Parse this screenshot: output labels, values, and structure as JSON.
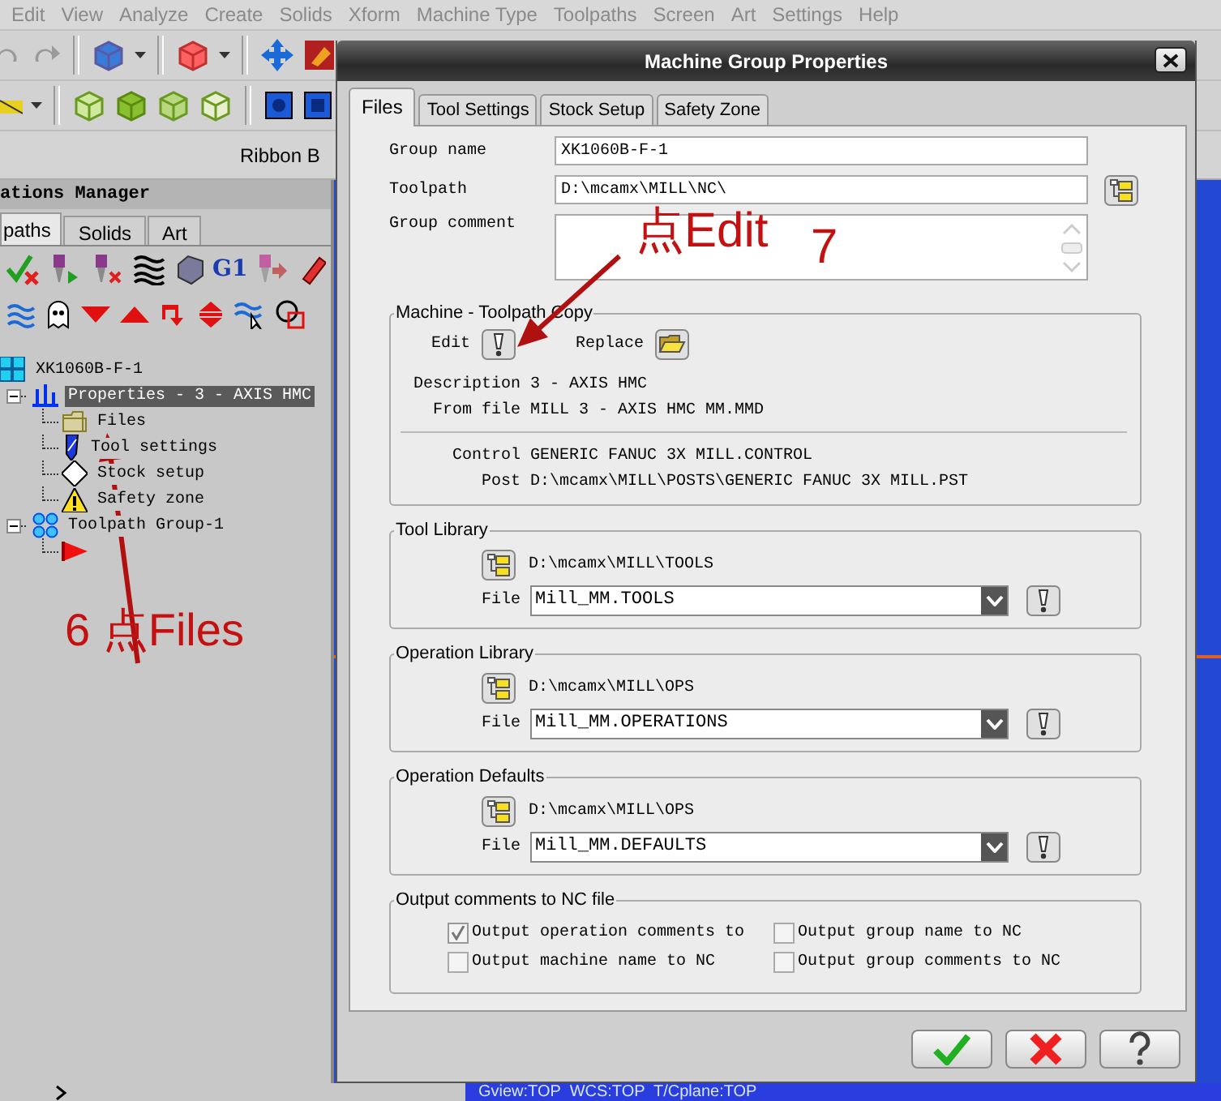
{
  "menu_bar": {
    "items": [
      "Edit",
      "View",
      "Analyze",
      "Create",
      "Solids",
      "Xform",
      "Machine Type",
      "Toolpaths",
      "Screen",
      "Art",
      "Settings",
      "Help"
    ]
  },
  "ribbon_bar": {
    "label": "Ribbon B"
  },
  "manager": {
    "title": "ations Manager",
    "tabs": [
      {
        "label": "paths",
        "selected": true
      },
      {
        "label": "Solids",
        "selected": false
      },
      {
        "label": "Art",
        "selected": false
      }
    ],
    "toolbar_label": "G1",
    "tree": [
      {
        "kind": "group",
        "label": "XK1060B-F-1",
        "selected": false,
        "children": [
          {
            "kind": "properties",
            "label": "Properties - 3 - AXIS HMC",
            "selected": true,
            "expanded": true,
            "children": [
              {
                "kind": "files",
                "label": "Files",
                "selected": false
              },
              {
                "kind": "tool",
                "label": "Tool settings",
                "selected": false
              },
              {
                "kind": "stock",
                "label": "Stock setup",
                "selected": false
              },
              {
                "kind": "safety",
                "label": "Safety zone",
                "selected": false
              }
            ]
          },
          {
            "kind": "toolpath_group",
            "label": "Toolpath Group-1",
            "selected": false,
            "expanded": true,
            "children": [
              {
                "kind": "insert_marker",
                "selected": false
              }
            ]
          }
        ]
      }
    ]
  },
  "status_bar": {
    "text": "Gview:TOP  WCS:TOP  T/Cplane:TOP"
  },
  "dialog": {
    "title": "Machine Group Properties",
    "tabs": [
      {
        "label": "Files",
        "selected": true
      },
      {
        "label": "Tool Settings",
        "selected": false
      },
      {
        "label": "Stock Setup",
        "selected": false
      },
      {
        "label": "Safety Zone",
        "selected": false
      }
    ],
    "group_name": {
      "label": "Group name",
      "value": "XK1060B-F-1"
    },
    "toolpath": {
      "label": "Toolpath",
      "value": "D:\\mcamx\\MILL\\NC\\"
    },
    "group_comment": {
      "label": "Group comment"
    },
    "machine_copy": {
      "title": "Machine - Toolpath Copy",
      "edit_label": "Edit",
      "replace_label": "Replace",
      "info": [
        {
          "label": "Description",
          "value": "3 - AXIS HMC"
        },
        {
          "label": "From file",
          "value": "MILL 3 - AXIS HMC MM.MMD"
        }
      ],
      "control": [
        {
          "label": "Control",
          "value": "GENERIC FANUC 3X MILL.CONTROL"
        },
        {
          "label": "Post",
          "value": "D:\\mcamx\\MILL\\POSTS\\GENERIC FANUC 3X MILL.PST"
        }
      ]
    },
    "libraries": [
      {
        "title": "Tool Library",
        "path": "D:\\mcamx\\MILL\\TOOLS",
        "file_label": "File",
        "file": "Mill_MM.TOOLS"
      },
      {
        "title": "Operation Library",
        "path": "D:\\mcamx\\MILL\\OPS",
        "file_label": "File",
        "file": "Mill_MM.OPERATIONS"
      },
      {
        "title": "Operation Defaults",
        "path": "D:\\mcamx\\MILL\\OPS",
        "file_label": "File",
        "file": "Mill_MM.DEFAULTS"
      }
    ],
    "output_comments": {
      "title": "Output comments to NC file",
      "options": [
        {
          "label": "Output operation comments to",
          "checked": true
        },
        {
          "label": "Output group name to NC",
          "checked": false
        },
        {
          "label": "Output machine name to NC",
          "checked": false
        },
        {
          "label": "Output group comments to NC",
          "checked": false
        }
      ]
    },
    "buttons": [
      {
        "kind": "ok"
      },
      {
        "kind": "cancel"
      },
      {
        "kind": "help"
      }
    ]
  },
  "annotations": [
    {
      "text": "点Edit"
    },
    {
      "text": "7"
    },
    {
      "text": "6 点Files"
    }
  ]
}
